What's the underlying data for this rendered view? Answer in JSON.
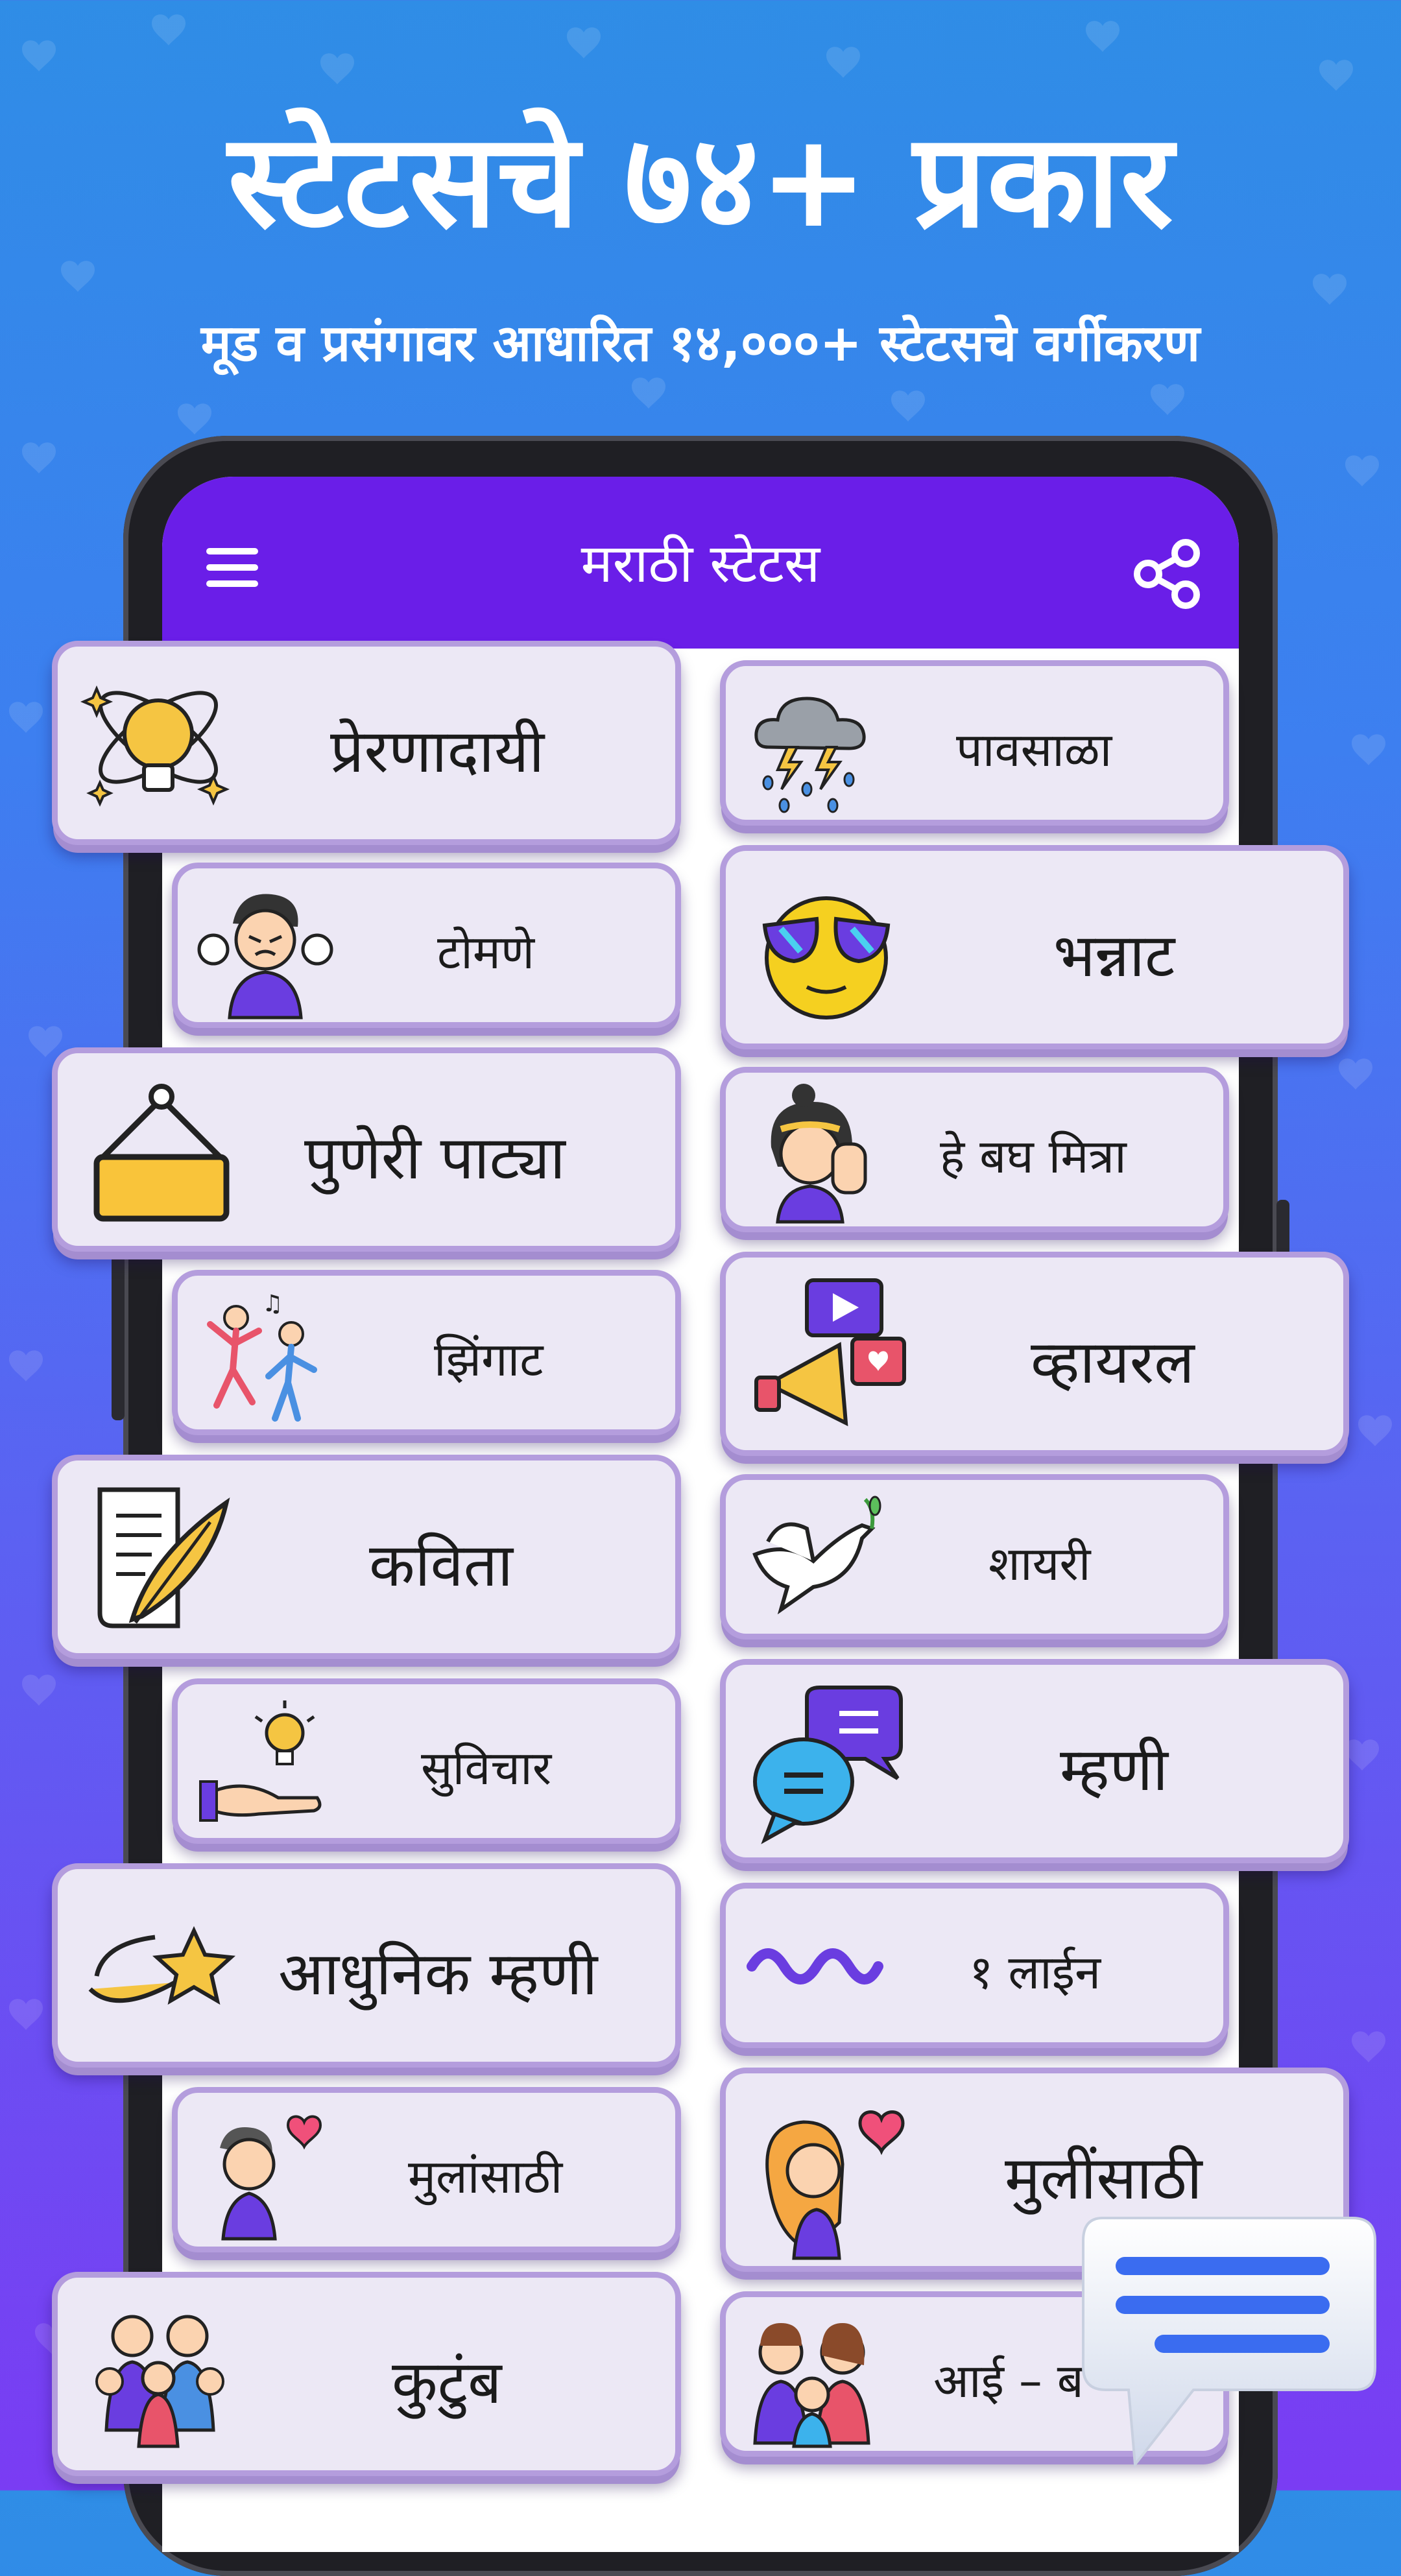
{
  "headline": "स्टेटसचे ७४+ प्रकार",
  "subheadline": "मूड व प्रसंगावर आधारित १४,०००+ स्टेटसचे वर्गीकरण",
  "app": {
    "title": "मराठी स्टेटस",
    "menu_icon": "hamburger-menu-icon",
    "share_icon": "share-icon",
    "accent_color": "#6a1ee8"
  },
  "categories_left": [
    {
      "label": "प्रेरणादायी",
      "icon": "lightbulb-atom-icon"
    },
    {
      "label": "टोमणे",
      "icon": "angry-man-icon"
    },
    {
      "label": "पुणेरी पाट्या",
      "icon": "hanging-sign-icon"
    },
    {
      "label": "झिंगाट",
      "icon": "dancing-people-icon"
    },
    {
      "label": "कविता",
      "icon": "quill-paper-icon"
    },
    {
      "label": "सुविचार",
      "icon": "idea-hand-icon"
    },
    {
      "label": "आधुनिक म्हणी",
      "icon": "shooting-star-icon"
    },
    {
      "label": "मुलांसाठी",
      "icon": "boy-heart-icon"
    },
    {
      "label": "कुटुंब",
      "icon": "family-group-icon"
    }
  ],
  "categories_right": [
    {
      "label": "पावसाळा",
      "icon": "rain-cloud-icon"
    },
    {
      "label": "भन्नाट",
      "icon": "cool-emoji-icon"
    },
    {
      "label": "हे बघ मित्रा",
      "icon": "girl-stop-hand-icon"
    },
    {
      "label": "व्हायरल",
      "icon": "megaphone-icon"
    },
    {
      "label": "शायरी",
      "icon": "dove-icon"
    },
    {
      "label": "म्हणी",
      "icon": "chat-bubbles-icon"
    },
    {
      "label": "१ लाईन",
      "icon": "wave-line-icon"
    },
    {
      "label": "मुलींसाठी",
      "icon": "girl-heart-icon"
    },
    {
      "label": "आई – ब",
      "icon": "parents-child-icon"
    }
  ],
  "fab_icon": "chat-message-icon"
}
